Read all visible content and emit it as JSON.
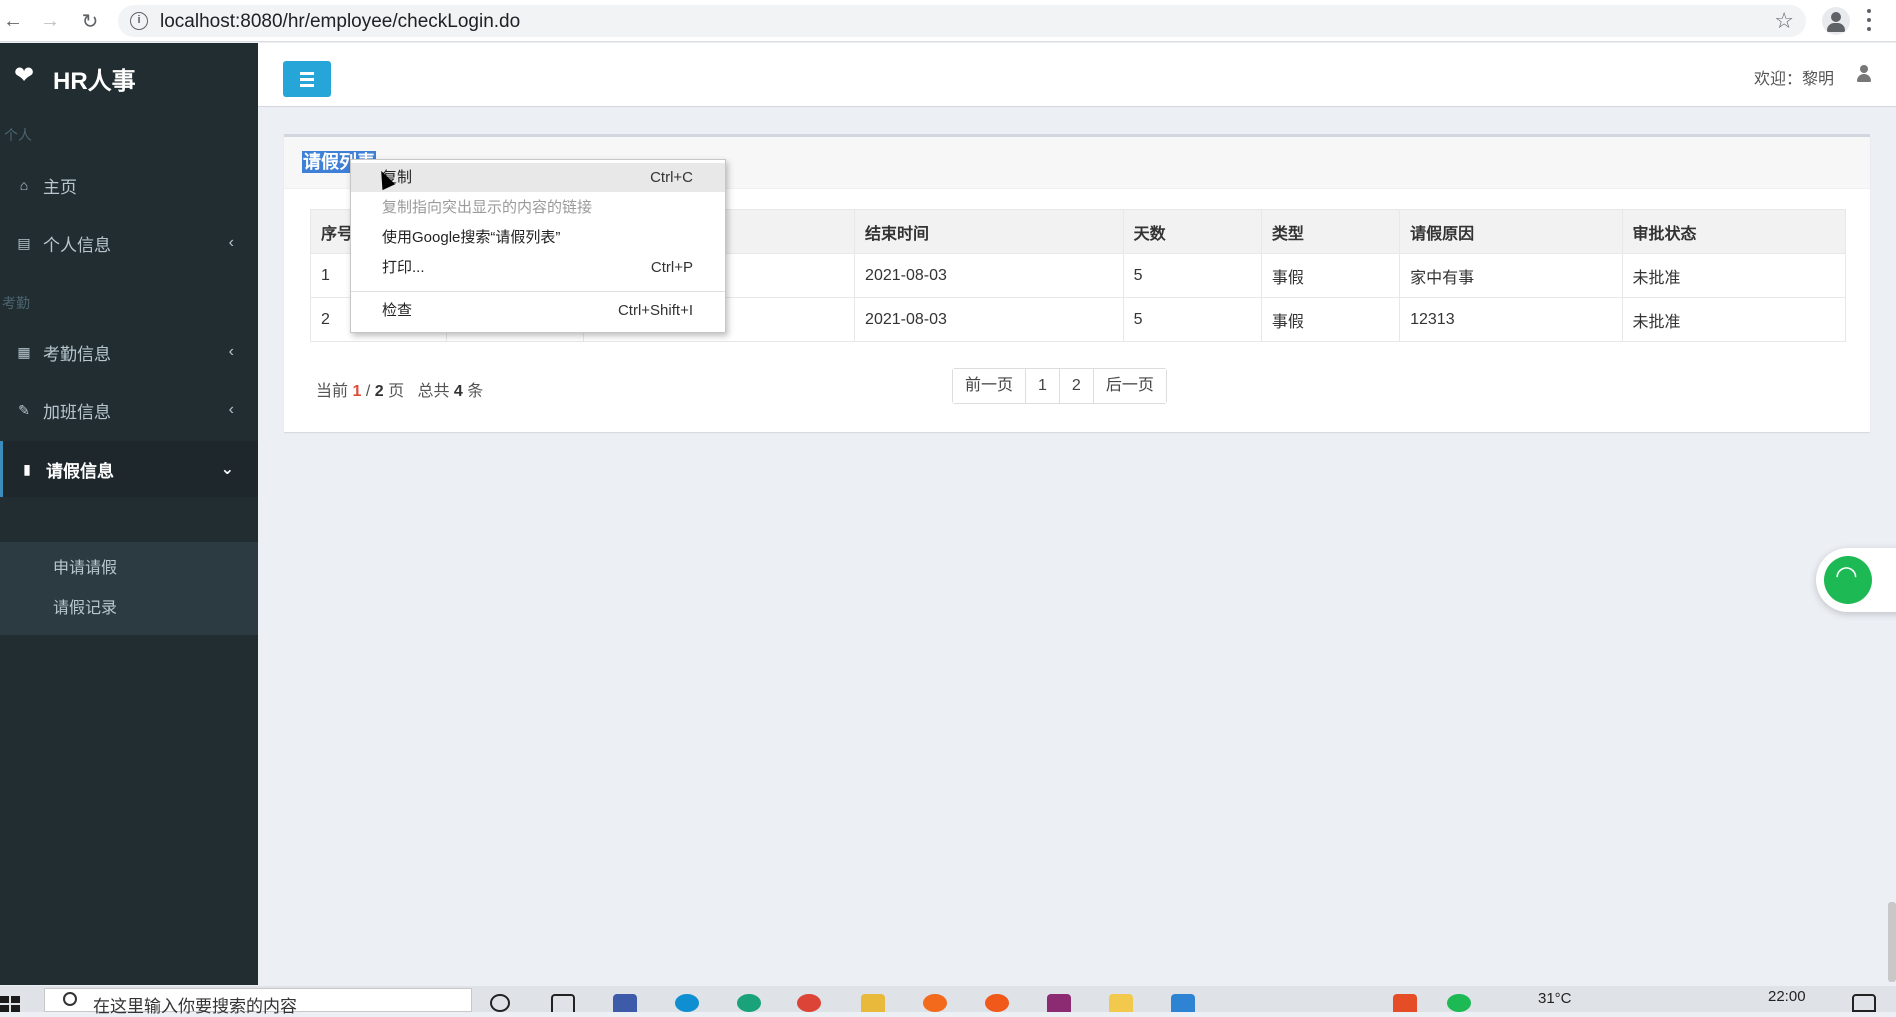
{
  "browser": {
    "url": "localhost:8080/hr/employee/checkLogin.do",
    "back_icon": "arrow-left-icon",
    "forward_icon": "arrow-right-icon",
    "reload_icon": "reload-icon"
  },
  "sidebar": {
    "logo_text": "HR人事",
    "section_personal": "个人",
    "section_attendance": "考勤",
    "items": [
      {
        "label": "主页",
        "icon": "home-icon"
      },
      {
        "label": "个人信息",
        "icon": "id-card-icon"
      },
      {
        "label": "考勤信息",
        "icon": "calendar-icon"
      },
      {
        "label": "加班信息",
        "icon": "edit-icon"
      },
      {
        "label": "请假信息",
        "icon": "bookmark-icon"
      }
    ],
    "submenu": [
      "申请请假",
      "请假记录"
    ]
  },
  "header": {
    "welcome": "欢迎：黎明"
  },
  "box": {
    "title": "请假列表"
  },
  "table": {
    "columns": [
      "序号",
      "",
      "",
      "结束时间",
      "天数",
      "类型",
      "请假原因",
      "审批状态"
    ],
    "rows": [
      [
        "1",
        "",
        "",
        "2021-08-03",
        "5",
        "事假",
        "家中有事",
        "未批准"
      ],
      [
        "2",
        "",
        "",
        "2021-08-03",
        "5",
        "事假",
        "12313",
        "未批准"
      ]
    ]
  },
  "pager": {
    "prefix": "当前",
    "current": "1",
    "slash": "/",
    "total_pages": "2",
    "page_word": "页",
    "total_prefix": "总共",
    "total_count": "4",
    "count_word": "条",
    "prev": "前一页",
    "page1": "1",
    "page2": "2",
    "next": "后一页"
  },
  "context_menu": {
    "items": [
      {
        "label": "复制",
        "shortcut": "Ctrl+C"
      },
      {
        "label": "复制指向突出显示的内容的链接",
        "shortcut": ""
      },
      {
        "label": "使用Google搜索“请假列表”",
        "shortcut": ""
      },
      {
        "label": "打印...",
        "shortcut": "Ctrl+P"
      },
      {
        "label": "检查",
        "shortcut": "Ctrl+Shift+I"
      }
    ]
  },
  "taskbar": {
    "search_placeholder": "在这里输入你要搜索的内容",
    "temperature": "31°C",
    "time": "22:00"
  },
  "colors": {
    "sidebar_bg": "#222d32",
    "accent": "#26a6d8",
    "highlight": "#3f80d6",
    "status_red": "#dd4b39"
  }
}
